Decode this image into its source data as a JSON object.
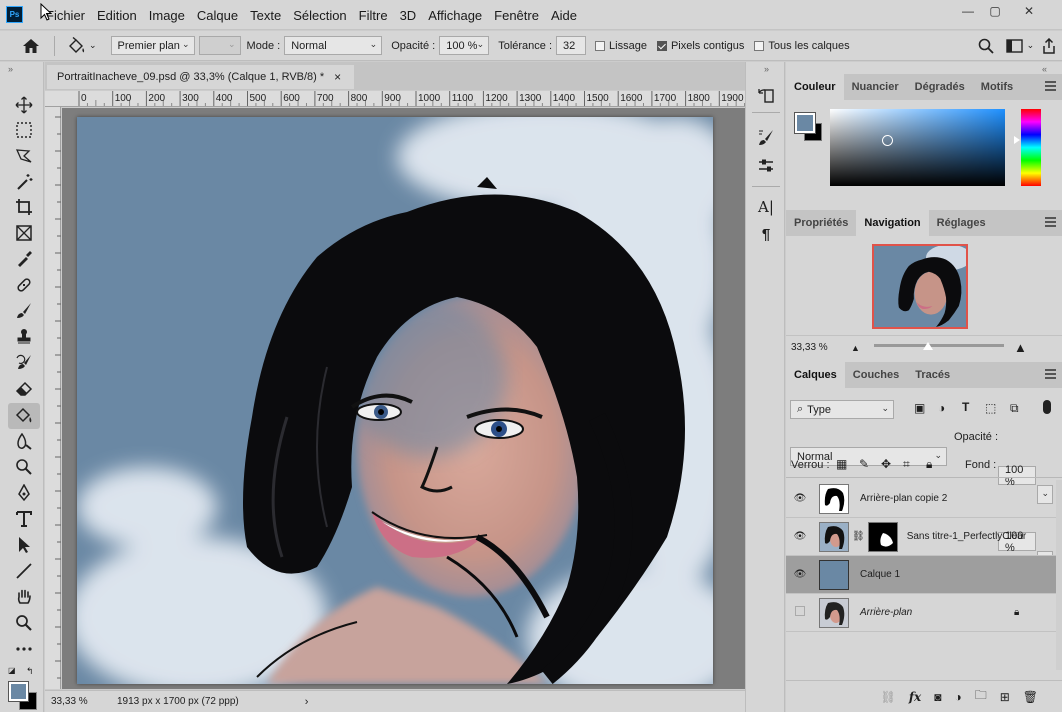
{
  "menubar": {
    "logo": "Ps",
    "items": [
      "Fichier",
      "Edition",
      "Image",
      "Calque",
      "Texte",
      "Sélection",
      "Filtre",
      "3D",
      "Affichage",
      "Fenêtre",
      "Aide"
    ],
    "window_buttons": [
      "—",
      "▢",
      "✕"
    ]
  },
  "options": {
    "mode_fill_label": "Premier plan",
    "mode_label": "Mode :",
    "mode_value": "Normal",
    "opacity_label": "Opacité :",
    "opacity_value": "100 %",
    "tolerance_label": "Tolérance :",
    "tolerance_value": "32",
    "lissage": "Lissage",
    "lissage_checked": false,
    "contigus": "Pixels contigus",
    "contigus_checked": true,
    "tous_calques": "Tous les calques",
    "tous_calques_checked": false
  },
  "document": {
    "tab_title": "PortraitInacheve_09.psd @ 33,3% (Calque 1, RVB/8) *",
    "ruler_ticks": [
      "0",
      "100",
      "200",
      "300",
      "400",
      "500",
      "600",
      "700",
      "800",
      "900",
      "1000",
      "1100",
      "1200",
      "1300",
      "1400",
      "1500",
      "1600",
      "1700",
      "1800",
      "1900"
    ],
    "zoom": "33,33 %",
    "doc_info": "1913 px x 1700 px (72 ppp)"
  },
  "tools": [
    "move-icon",
    "marquee-icon",
    "lasso-icon",
    "magic-wand-icon",
    "crop-icon",
    "frame-icon",
    "eyedropper-icon",
    "healing-icon",
    "brush-icon",
    "stamp-icon",
    "history-brush-icon",
    "eraser-icon",
    "paint-bucket-icon",
    "blur-icon",
    "dodge-icon",
    "pen-icon",
    "type-icon",
    "path-select-icon",
    "line-icon",
    "hand-icon",
    "zoom-icon",
    "more-icon"
  ],
  "colors": {
    "foreground": "#6a88a4",
    "background": "#000000",
    "canvas": "#6a88a4"
  },
  "panels": {
    "color_tabs": [
      "Couleur",
      "Nuancier",
      "Dégradés",
      "Motifs"
    ],
    "nav_tabs": [
      "Propriétés",
      "Navigation",
      "Réglages"
    ],
    "nav_zoom": "33,33 %",
    "layers_tabs": [
      "Calques",
      "Couches",
      "Tracés"
    ],
    "filter_type": "Type",
    "blend_mode": "Normal",
    "opacity_label": "Opacité :",
    "opacity_value": "100 %",
    "lock_label": "Verrou :",
    "fill_label": "Fond :",
    "fill_value": "100 %",
    "layers": [
      {
        "name": "Arrière-plan copie 2",
        "visible": true,
        "selected": false,
        "italic": false
      },
      {
        "name": "Sans titre-1_PerfectlyClear",
        "visible": true,
        "selected": false,
        "italic": false
      },
      {
        "name": "Calque 1",
        "visible": true,
        "selected": true,
        "italic": false
      },
      {
        "name": "Arrière-plan",
        "visible": false,
        "selected": false,
        "italic": true
      }
    ]
  }
}
